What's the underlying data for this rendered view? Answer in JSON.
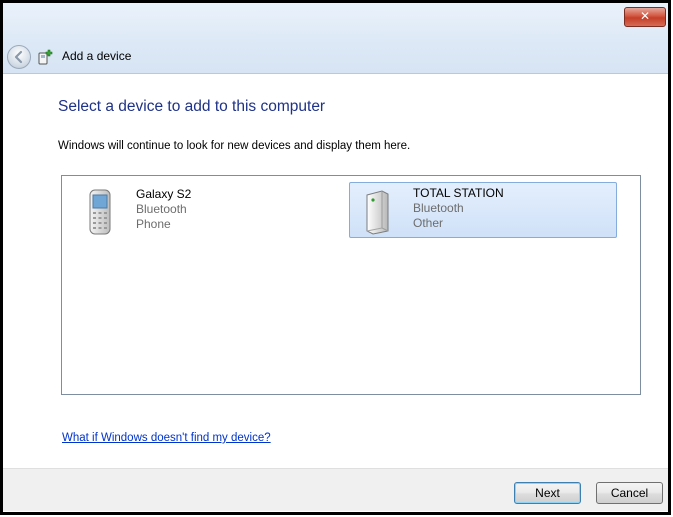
{
  "window": {
    "close_glyph": "✕",
    "title": "Add a device"
  },
  "main": {
    "heading": "Select a device to add to this computer",
    "description": "Windows will continue to look for new devices and display them here."
  },
  "devices": [
    {
      "name": "Galaxy S2",
      "connection": "Bluetooth",
      "category": "Phone",
      "icon": "phone-icon",
      "selected": false
    },
    {
      "name": "TOTAL STATION",
      "connection": "Bluetooth",
      "category": "Other",
      "icon": "generic-device-icon",
      "selected": true
    }
  ],
  "help_link": "What if Windows doesn't find my device?",
  "buttons": {
    "next": "Next",
    "cancel": "Cancel"
  },
  "colors": {
    "heading": "#1e3287",
    "link": "#0033cc",
    "selection": "#cfe1f8",
    "close_button": "#c43e28"
  }
}
